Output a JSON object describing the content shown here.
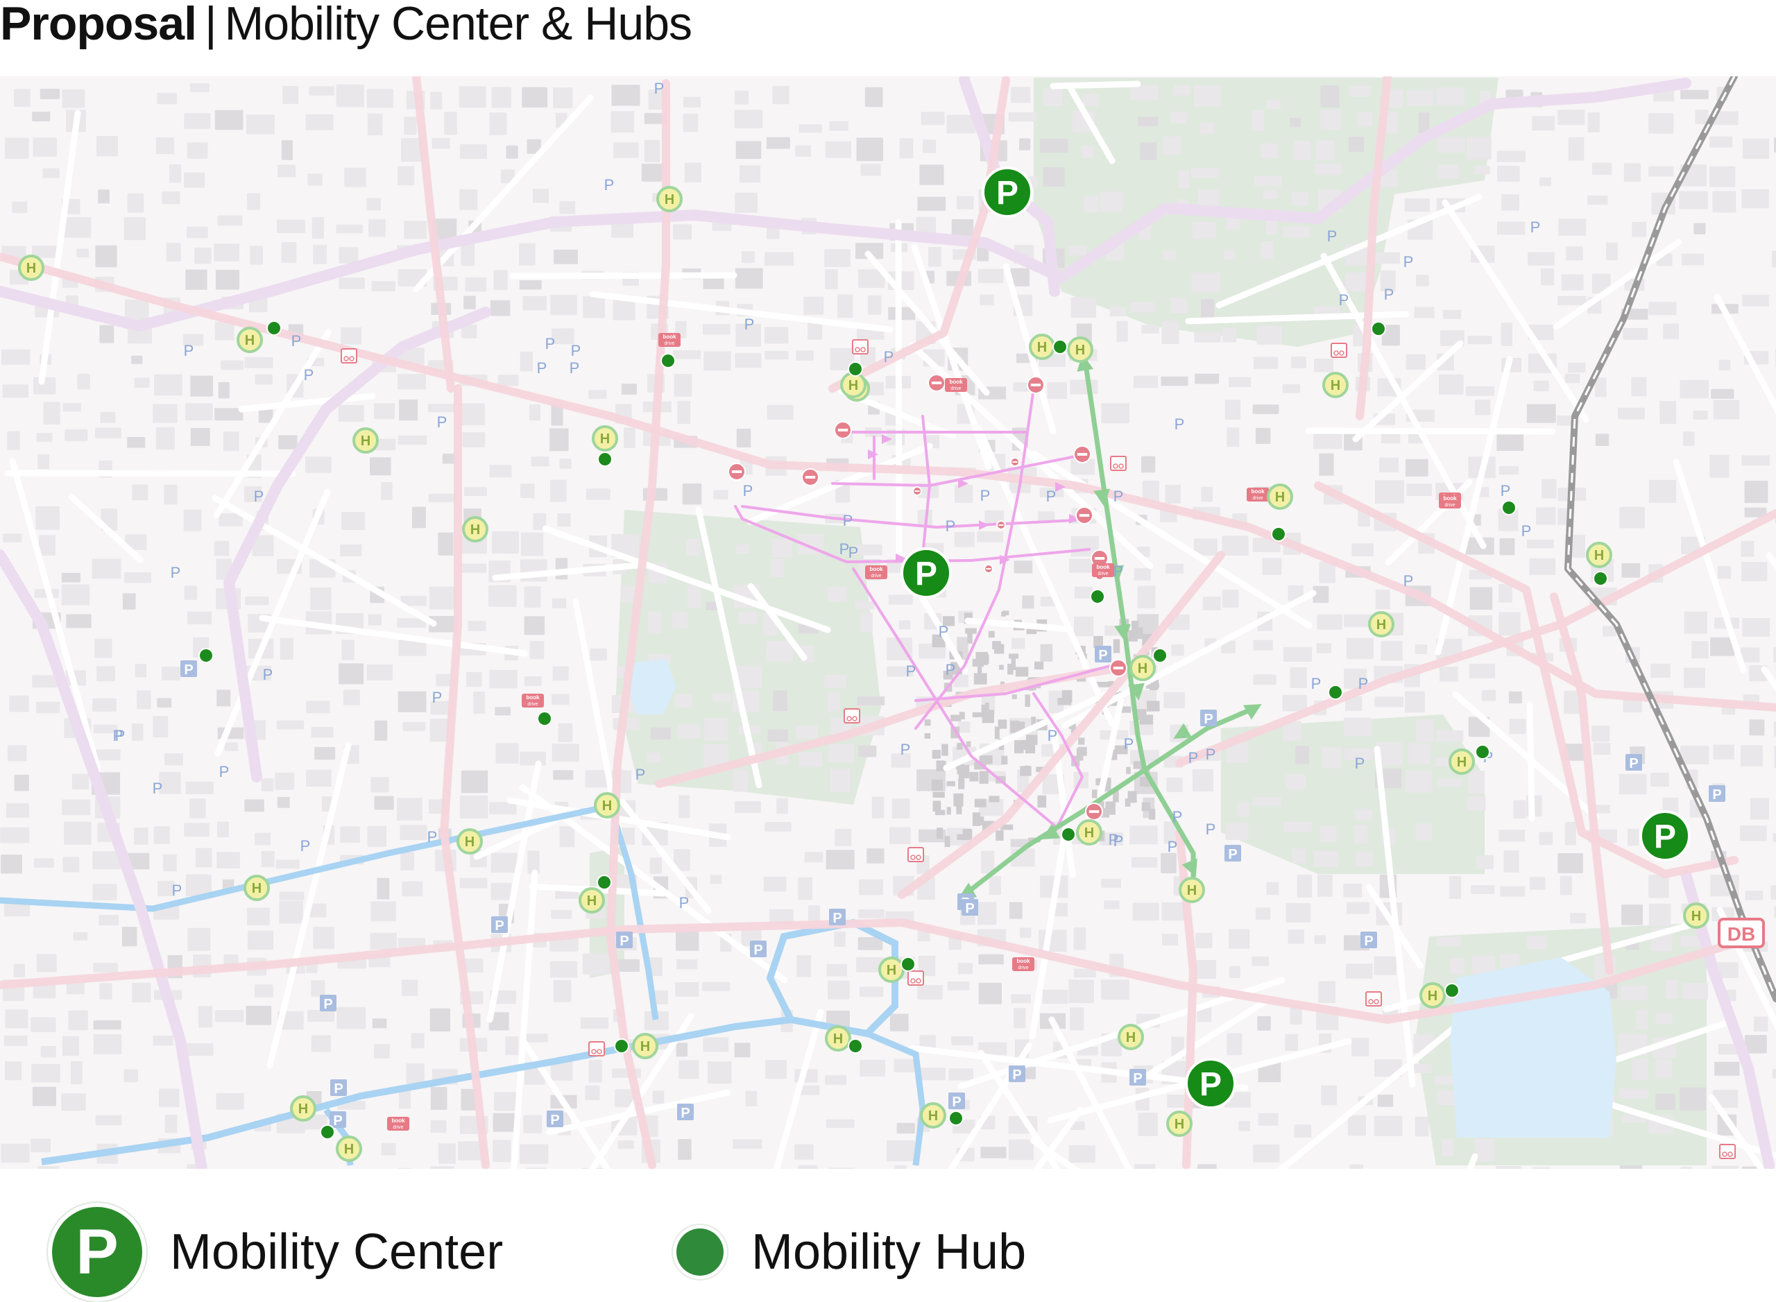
{
  "title": {
    "bold": "Proposal",
    "separator": "|",
    "subtitle": "Mobility Center & Hubs"
  },
  "map": {
    "colors": {
      "background": "#f7f5f6",
      "block": "#e9e7e9",
      "minor_road": "#ffffff",
      "major_road": "#f6d5dc",
      "ring_road": "#ecdcef",
      "park": "#dfe9de",
      "water": "#a9d3f2",
      "pink_route": "#eea6ea",
      "green_route": "#8fcf94",
      "center": "#168b17",
      "hub": "#1d8a1d",
      "bus_stop_fill": "#f3f0a6",
      "bus_stop_ring": "#9fd59a",
      "parking_text": "#8aa6d6",
      "parking_box": "#a9bde0",
      "no_entry": "#e57f8c",
      "db_red": "#e77a86"
    },
    "center_symbol": "P",
    "bus_stop_symbol": "H",
    "parking_symbol": "P",
    "book_drive_line1": "book",
    "book_drive_line2": "drive",
    "db_symbol": "DB"
  },
  "legend": {
    "center_symbol": "P",
    "center_label": "Mobility Center",
    "hub_label": "Mobility Hub"
  }
}
